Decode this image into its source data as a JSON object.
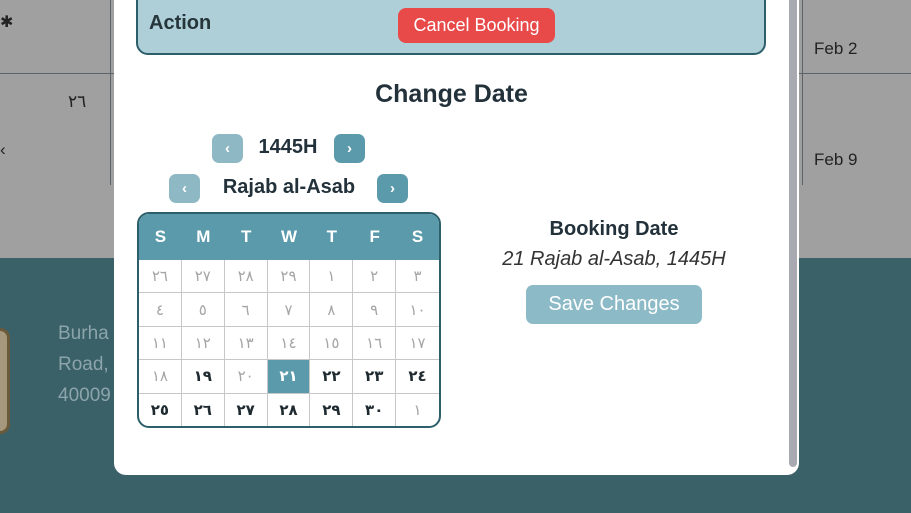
{
  "background": {
    "rows": [
      {
        "arabic_date": "٢٦",
        "gregorian": "Feb 2"
      },
      {
        "arabic_date": "",
        "gregorian": "Feb 9"
      }
    ],
    "footer_lines": [
      "Burha",
      "Road,",
      "40009"
    ]
  },
  "modal": {
    "action_label": "Action",
    "cancel_label": "Cancel Booking",
    "title": "Change Date",
    "year_label": "1445H",
    "month_label": "Rajab al-Asab",
    "prev_glyph": "‹",
    "next_glyph": "›",
    "weekdays": [
      "S",
      "M",
      "T",
      "W",
      "T",
      "F",
      "S"
    ],
    "weeks": [
      [
        {
          "d": "٢٦",
          "cur": false
        },
        {
          "d": "٢٧",
          "cur": false
        },
        {
          "d": "٢٨",
          "cur": false
        },
        {
          "d": "٢٩",
          "cur": false
        },
        {
          "d": "١",
          "cur": false
        },
        {
          "d": "٢",
          "cur": false
        },
        {
          "d": "٣",
          "cur": false
        }
      ],
      [
        {
          "d": "٤",
          "cur": false
        },
        {
          "d": "٥",
          "cur": false
        },
        {
          "d": "٦",
          "cur": false
        },
        {
          "d": "٧",
          "cur": false
        },
        {
          "d": "٨",
          "cur": false
        },
        {
          "d": "٩",
          "cur": false
        },
        {
          "d": "١٠",
          "cur": false
        }
      ],
      [
        {
          "d": "١١",
          "cur": false
        },
        {
          "d": "١٢",
          "cur": false
        },
        {
          "d": "١٣",
          "cur": false
        },
        {
          "d": "١٤",
          "cur": false
        },
        {
          "d": "١٥",
          "cur": false
        },
        {
          "d": "١٦",
          "cur": false
        },
        {
          "d": "١٧",
          "cur": false
        }
      ],
      [
        {
          "d": "١٨",
          "cur": false
        },
        {
          "d": "١٩",
          "cur": true
        },
        {
          "d": "٢٠",
          "cur": false
        },
        {
          "d": "٢١",
          "cur": true,
          "selected": true
        },
        {
          "d": "٢٢",
          "cur": true
        },
        {
          "d": "٢٣",
          "cur": true
        },
        {
          "d": "٢٤",
          "cur": true
        }
      ],
      [
        {
          "d": "٢٥",
          "cur": true
        },
        {
          "d": "٢٦",
          "cur": true
        },
        {
          "d": "٢٧",
          "cur": true
        },
        {
          "d": "٢٨",
          "cur": true
        },
        {
          "d": "٢٩",
          "cur": true
        },
        {
          "d": "٣٠",
          "cur": true
        },
        {
          "d": "١",
          "cur": false
        }
      ]
    ],
    "booking_title": "Booking Date",
    "booking_value": "21 Rajab al-Asab, 1445H",
    "save_label": "Save Changes"
  },
  "colors": {
    "accent": "#5a9aaa",
    "danger": "#e84a4a",
    "footer": "#3a6068"
  }
}
